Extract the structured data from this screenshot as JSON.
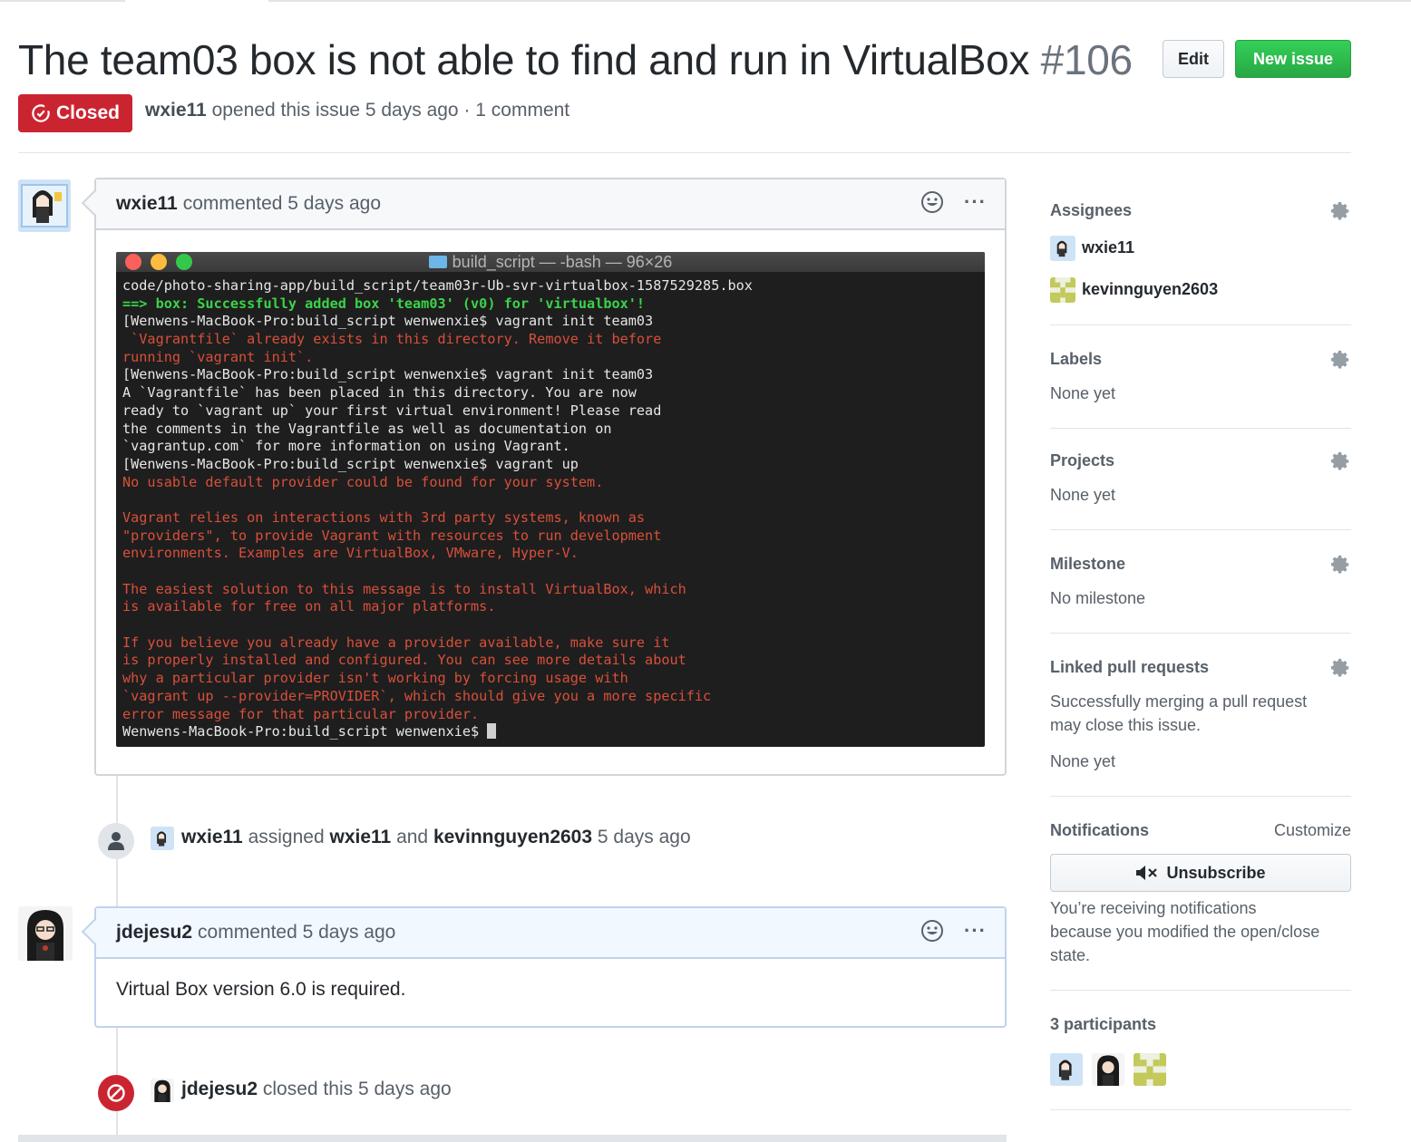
{
  "issue": {
    "title": "The team03 box is not able to find and run in VirtualBox",
    "number": "#106",
    "state": "Closed",
    "author": "wxie11",
    "opened_text": "opened this issue 5 days ago · 1 comment"
  },
  "header_buttons": {
    "edit": "Edit",
    "new_issue": "New issue"
  },
  "comments": [
    {
      "author": "wxie11",
      "time_text": "commented 5 days ago",
      "terminal": {
        "title": "build_script — -bash — 96×26",
        "lines": [
          {
            "text": "code/photo-sharing-app/build_script/team03r-Ub-svr-virtualbox-1587529285.box",
            "color": "w"
          },
          {
            "text": "==> box: Successfully added box 'team03' (v0) for 'virtualbox'!",
            "color": "g"
          },
          {
            "text": "[Wenwens-MacBook-Pro:build_script wenwenxie$ vagrant init team03",
            "color": "w"
          },
          {
            "text": " `Vagrantfile` already exists in this directory. Remove it before",
            "color": "r"
          },
          {
            "text": "running `vagrant init`.",
            "color": "r"
          },
          {
            "text": "[Wenwens-MacBook-Pro:build_script wenwenxie$ vagrant init team03",
            "color": "w"
          },
          {
            "text": "A `Vagrantfile` has been placed in this directory. You are now",
            "color": "w"
          },
          {
            "text": "ready to `vagrant up` your first virtual environment! Please read",
            "color": "w"
          },
          {
            "text": "the comments in the Vagrantfile as well as documentation on",
            "color": "w"
          },
          {
            "text": "`vagrantup.com` for more information on using Vagrant.",
            "color": "w"
          },
          {
            "text": "[Wenwens-MacBook-Pro:build_script wenwenxie$ vagrant up",
            "color": "w"
          },
          {
            "text": "No usable default provider could be found for your system.",
            "color": "r"
          },
          {
            "text": "",
            "color": "r"
          },
          {
            "text": "Vagrant relies on interactions with 3rd party systems, known as",
            "color": "r"
          },
          {
            "text": "\"providers\", to provide Vagrant with resources to run development",
            "color": "r"
          },
          {
            "text": "environments. Examples are VirtualBox, VMware, Hyper-V.",
            "color": "r"
          },
          {
            "text": "",
            "color": "r"
          },
          {
            "text": "The easiest solution to this message is to install VirtualBox, which",
            "color": "r"
          },
          {
            "text": "is available for free on all major platforms.",
            "color": "r"
          },
          {
            "text": "",
            "color": "r"
          },
          {
            "text": "If you believe you already have a provider available, make sure it",
            "color": "r"
          },
          {
            "text": "is properly installed and configured. You can see more details about",
            "color": "r"
          },
          {
            "text": "why a particular provider isn't working by forcing usage with",
            "color": "r"
          },
          {
            "text": "`vagrant up --provider=PROVIDER`, which should give you a more specific",
            "color": "r"
          },
          {
            "text": "error message for that particular provider.",
            "color": "r"
          },
          {
            "text": "Wenwens-MacBook-Pro:build_script wenwenxie$ ",
            "color": "w"
          }
        ]
      }
    },
    {
      "author": "jdejesu2",
      "time_text": "commented 5 days ago",
      "body": "Virtual Box version 6.0 is required."
    }
  ],
  "events": {
    "assigned": {
      "actor": "wxie11",
      "verb": "assigned",
      "user1": "wxie11",
      "and": "and",
      "user2": "kevinnguyen2603",
      "time": "5 days ago"
    },
    "closed": {
      "actor": "jdejesu2",
      "text": "closed this 5 days ago"
    }
  },
  "sidebar": {
    "assignees": {
      "heading": "Assignees",
      "users": [
        "wxie11",
        "kevinnguyen2603"
      ]
    },
    "labels": {
      "heading": "Labels",
      "value": "None yet"
    },
    "projects": {
      "heading": "Projects",
      "value": "None yet"
    },
    "milestone": {
      "heading": "Milestone",
      "value": "No milestone"
    },
    "linked_prs": {
      "heading": "Linked pull requests",
      "line1": "Successfully merging a pull request",
      "line2": "may close this issue.",
      "value": "None yet"
    },
    "notifications": {
      "heading": "Notifications",
      "customize": "Customize",
      "unsubscribe": "Unsubscribe",
      "line1": "You’re receiving notifications",
      "line2": "because you modified the open/close",
      "line3": "state."
    },
    "participants": {
      "heading": "3 participants"
    }
  },
  "colors": {
    "closed_red": "#cb2431",
    "new_issue_green": "#28a745",
    "terminal_bg": "#1e1e1e",
    "terminal_green": "#3bd34a",
    "terminal_red": "#d94f3a"
  }
}
